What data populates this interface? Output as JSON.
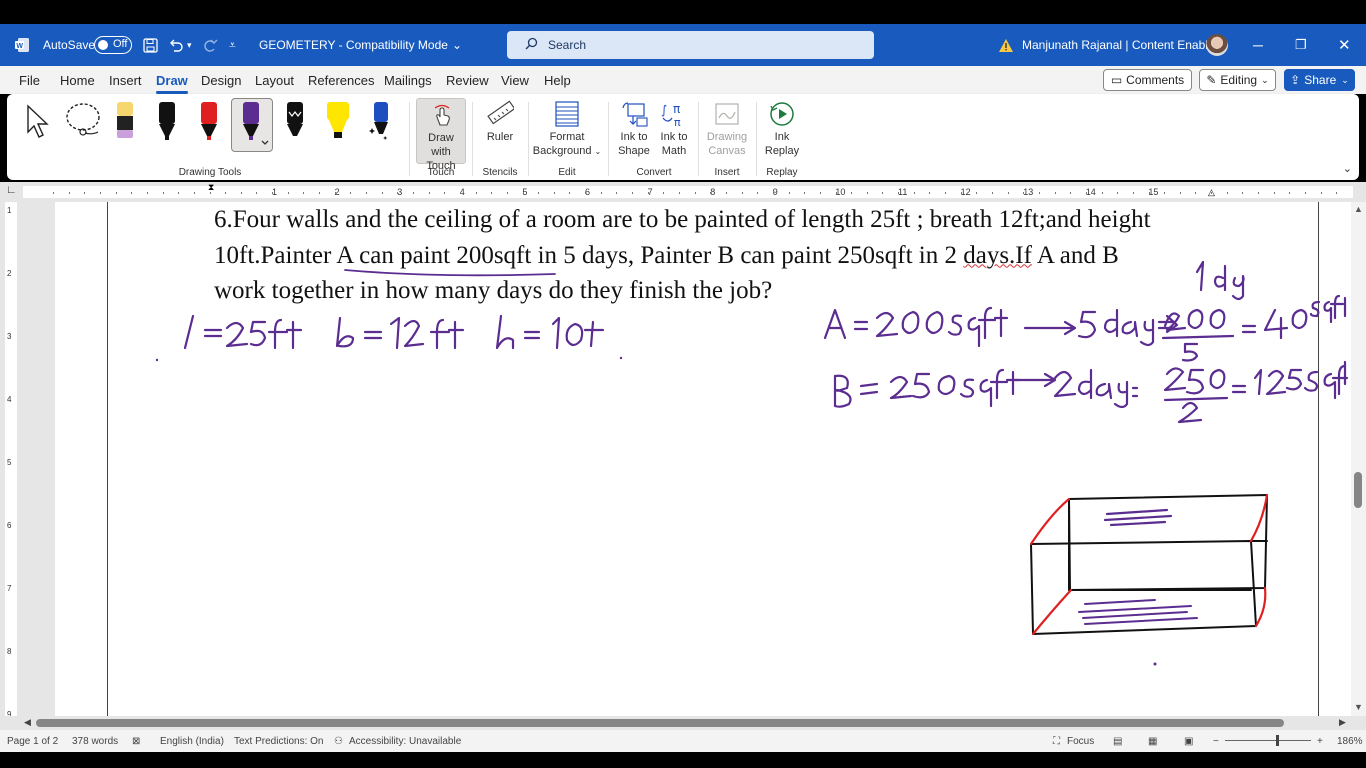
{
  "titlebar": {
    "autosave_label": "AutoSave",
    "autosave_state": "Off",
    "doc_title": "GEOMETERY  -  Compatibility Mode",
    "search_placeholder": "Search",
    "user_name": "Manjunath Rajanal | Content Enablers",
    "accent_color": "#185abd"
  },
  "menu": {
    "tabs": [
      "File",
      "Home",
      "Insert",
      "Draw",
      "Design",
      "Layout",
      "References",
      "Mailings",
      "Review",
      "View",
      "Help"
    ],
    "active_tab": "Draw",
    "comments_label": "Comments",
    "editing_label": "Editing",
    "share_label": "Share"
  },
  "ribbon": {
    "draw_with_touch": "Draw with Touch",
    "ruler": "Ruler",
    "format_background": "Format Background",
    "ink_to_shape": "Ink to Shape",
    "ink_to_math": "Ink to Math",
    "drawing_canvas": "Drawing Canvas",
    "ink_replay": "Ink Replay",
    "groups": {
      "drawing_tools": "Drawing Tools",
      "touch": "Touch",
      "stencils": "Stencils",
      "edit": "Edit",
      "convert": "Convert",
      "insert": "Insert",
      "replay": "Replay"
    },
    "pen_colors": [
      "#f5d76e",
      "#111111",
      "#e02020",
      "#5b2d91",
      "#111111",
      "#ffe600",
      "#1f4fbf"
    ]
  },
  "ruler": {
    "numbers": [
      "1",
      "2",
      "3",
      "4",
      "5",
      "6",
      "7",
      "8",
      "9",
      "10",
      "11",
      "12",
      "13",
      "14",
      "15"
    ],
    "vertical_numbers": [
      "1",
      "2",
      "3",
      "4",
      "5",
      "6",
      "7",
      "8",
      "9"
    ]
  },
  "document": {
    "question_line1": "6.Four walls and the ceiling of a room are to be painted of length 25ft ; breath 12ft;and height",
    "question_line2_pre": "10ft.Painter ",
    "question_line2_underlined": "A can paint 200sqft",
    "question_line2_mid": " in 5 days, Painter B can paint 250sqft in 2 ",
    "question_line2_squiggle": "days.If",
    "question_line2_post": " A and B",
    "question_line3": "work together in how many days do they finish the job?",
    "ink": {
      "dimensions": "l = 25ft    b = 12ft    h = 10ft",
      "painter_a": "A = 200sqft ⟶ 5days ⇒ 200/5 = 40 sqft",
      "painter_b": "B = 250sqft ⟶ 2day = 250/2 = 125 sqft",
      "note": "1 day",
      "ink_color": "#5b2d91",
      "edge_color": "#e02020"
    }
  },
  "statusbar": {
    "page": "Page 1 of 2",
    "words": "378 words",
    "language": "English (India)",
    "text_predictions": "Text Predictions: On",
    "accessibility": "Accessibility: Unavailable",
    "focus": "Focus",
    "zoom_minus": "−",
    "zoom_plus": "+",
    "zoom_level": "186%"
  }
}
